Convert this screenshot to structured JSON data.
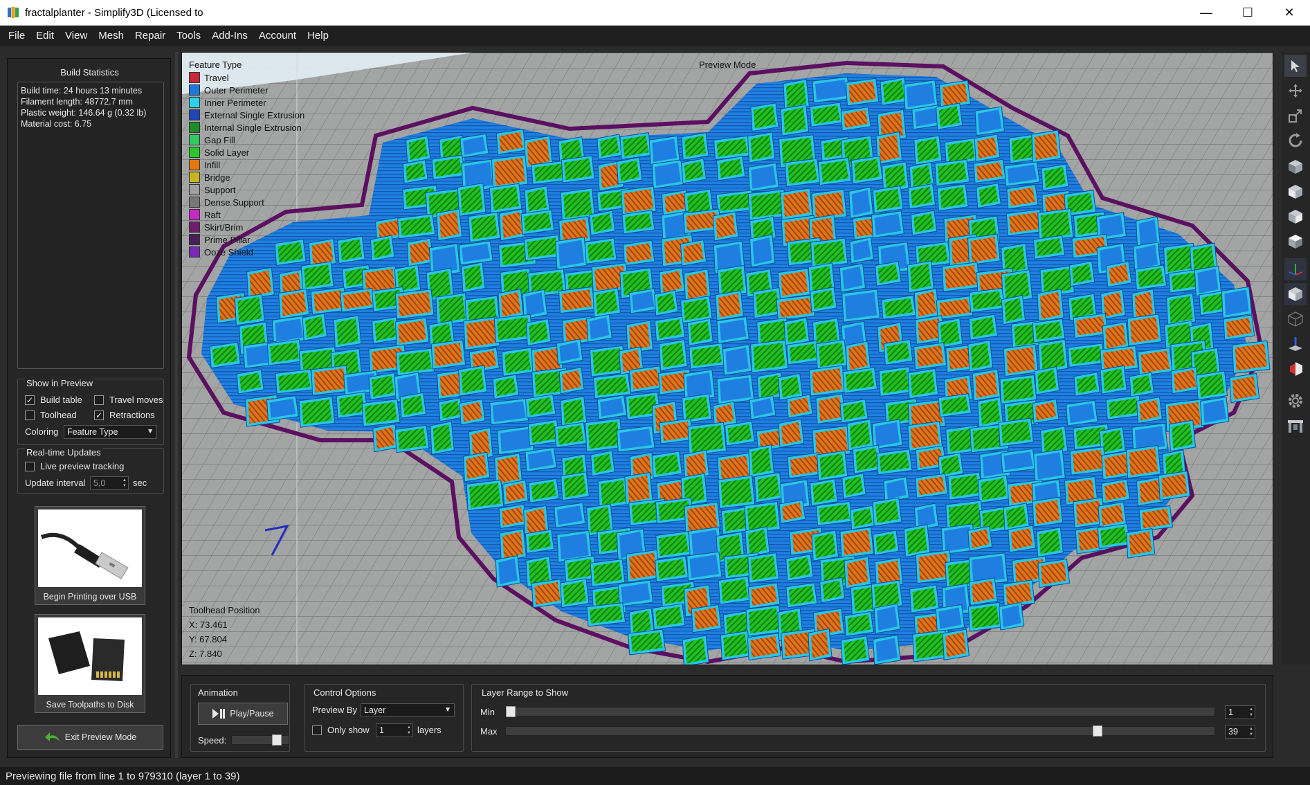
{
  "window": {
    "title": "fractalplanter - Simplify3D (Licensed to",
    "minimize": "—",
    "maximize": "☐",
    "close": "✕"
  },
  "menu": [
    "File",
    "Edit",
    "View",
    "Mesh",
    "Repair",
    "Tools",
    "Add-Ins",
    "Account",
    "Help"
  ],
  "left": {
    "build_stats_title": "Build Statistics",
    "stats": [
      "Build time: 24 hours 13 minutes",
      "Filament length: 48772.7 mm",
      "Plastic weight: 146.64 g (0.32 lb)",
      "Material cost: 6.75"
    ],
    "show_in_preview": {
      "title": "Show in Preview",
      "build_table": {
        "label": "Build table",
        "checked": true
      },
      "travel_moves": {
        "label": "Travel moves",
        "checked": false
      },
      "toolhead": {
        "label": "Toolhead",
        "checked": false
      },
      "retractions": {
        "label": "Retractions",
        "checked": true
      },
      "coloring_label": "Coloring",
      "coloring_value": "Feature Type"
    },
    "realtime": {
      "title": "Real-time Updates",
      "live_tracking": {
        "label": "Live preview tracking",
        "checked": false
      },
      "interval_label": "Update interval",
      "interval_value": "5,0",
      "interval_unit": "sec"
    },
    "usb_button": "Begin Printing over USB",
    "disk_button": "Save Toolpaths to Disk",
    "exit_button": "Exit Preview Mode"
  },
  "viewport": {
    "legend_title": "Feature Type",
    "preview_mode": "Preview Mode",
    "legend": [
      {
        "label": "Travel",
        "color": "#c8283c"
      },
      {
        "label": "Outer Perimeter",
        "color": "#1e78dc"
      },
      {
        "label": "Inner Perimeter",
        "color": "#2ad4e8"
      },
      {
        "label": "External Single Extrusion",
        "color": "#1e46b4"
      },
      {
        "label": "Internal Single Extrusion",
        "color": "#1e8c28"
      },
      {
        "label": "Gap Fill",
        "color": "#32c864"
      },
      {
        "label": "Solid Layer",
        "color": "#28c828"
      },
      {
        "label": "Infill",
        "color": "#e67814"
      },
      {
        "label": "Bridge",
        "color": "#c8b41e"
      },
      {
        "label": "Support",
        "color": "#a0a0a0"
      },
      {
        "label": "Dense Support",
        "color": "#787878"
      },
      {
        "label": "Raft",
        "color": "#c828c8"
      },
      {
        "label": "Skirt/Brim",
        "color": "#6e1e6e"
      },
      {
        "label": "Prime Pillar",
        "color": "#4a1e5a"
      },
      {
        "label": "Ooze Shield",
        "color": "#7828b4"
      }
    ],
    "toolhead_title": "Toolhead Position",
    "toolhead": [
      "X: 73.461",
      "Y: 67.804",
      "Z: 7.840"
    ]
  },
  "bottom": {
    "animation_title": "Animation",
    "play_pause": "Play/Pause",
    "speed_label": "Speed:",
    "speed_level": 0.85,
    "control_title": "Control Options",
    "preview_by_label": "Preview By",
    "preview_by_value": "Layer",
    "only_show_label": "Only show",
    "only_show_value": "1",
    "layers_label": "layers",
    "layer_range_title": "Layer Range to Show",
    "min_label": "Min",
    "max_label": "Max",
    "min_value": "1",
    "max_value": "39",
    "min_fraction": 0.0,
    "max_fraction": 0.84
  },
  "status": "Previewing file from line 1 to 979310 (layer 1 to 39)"
}
